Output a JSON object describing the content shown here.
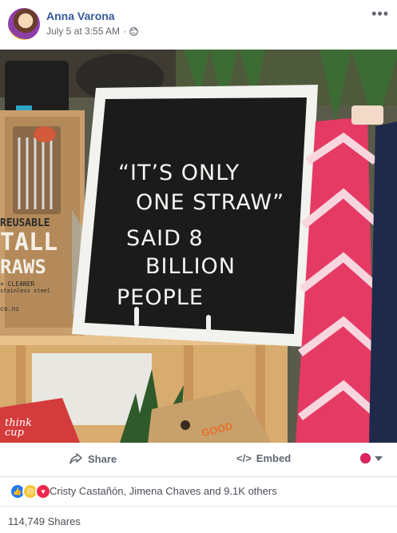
{
  "post": {
    "author": "Anna Varona",
    "timestamp": "July 5 at 3:55 AM",
    "separator": "·",
    "more_icon": "more-horizontal-icon",
    "privacy_icon": "globe-icon"
  },
  "photo": {
    "letterboard_lines": [
      "“IT’S ONLY",
      "ONE STRAW”",
      "SAID 8",
      "BILLION",
      "PEOPLE"
    ],
    "box_label_top": "REUSABLE",
    "box_label_mid": "TALL",
    "box_label_bottom": "RAWS",
    "box_small_1": "+ CLEANER",
    "box_small_2": "stainless steel",
    "box_url": "co.nz",
    "cup_label": "think cup",
    "bag_label": "GOOD"
  },
  "actions": {
    "share_label": "Share",
    "share_icon": "share-arrow-icon",
    "embed_label": "Embed",
    "embed_icon": "code-icon",
    "audience_icon": "audience-selector-icon"
  },
  "reactions": {
    "icons": [
      "like-icon",
      "sad-icon",
      "love-icon"
    ],
    "summary": "Cristy Castañón, Jimena Chaves and 9.1K others"
  },
  "shares": {
    "count_text": "114,749 Shares"
  },
  "colors": {
    "link": "#365899",
    "meta": "#616770",
    "like": "#2078f4",
    "love": "#f0284a",
    "sad": "#f7c53b"
  }
}
